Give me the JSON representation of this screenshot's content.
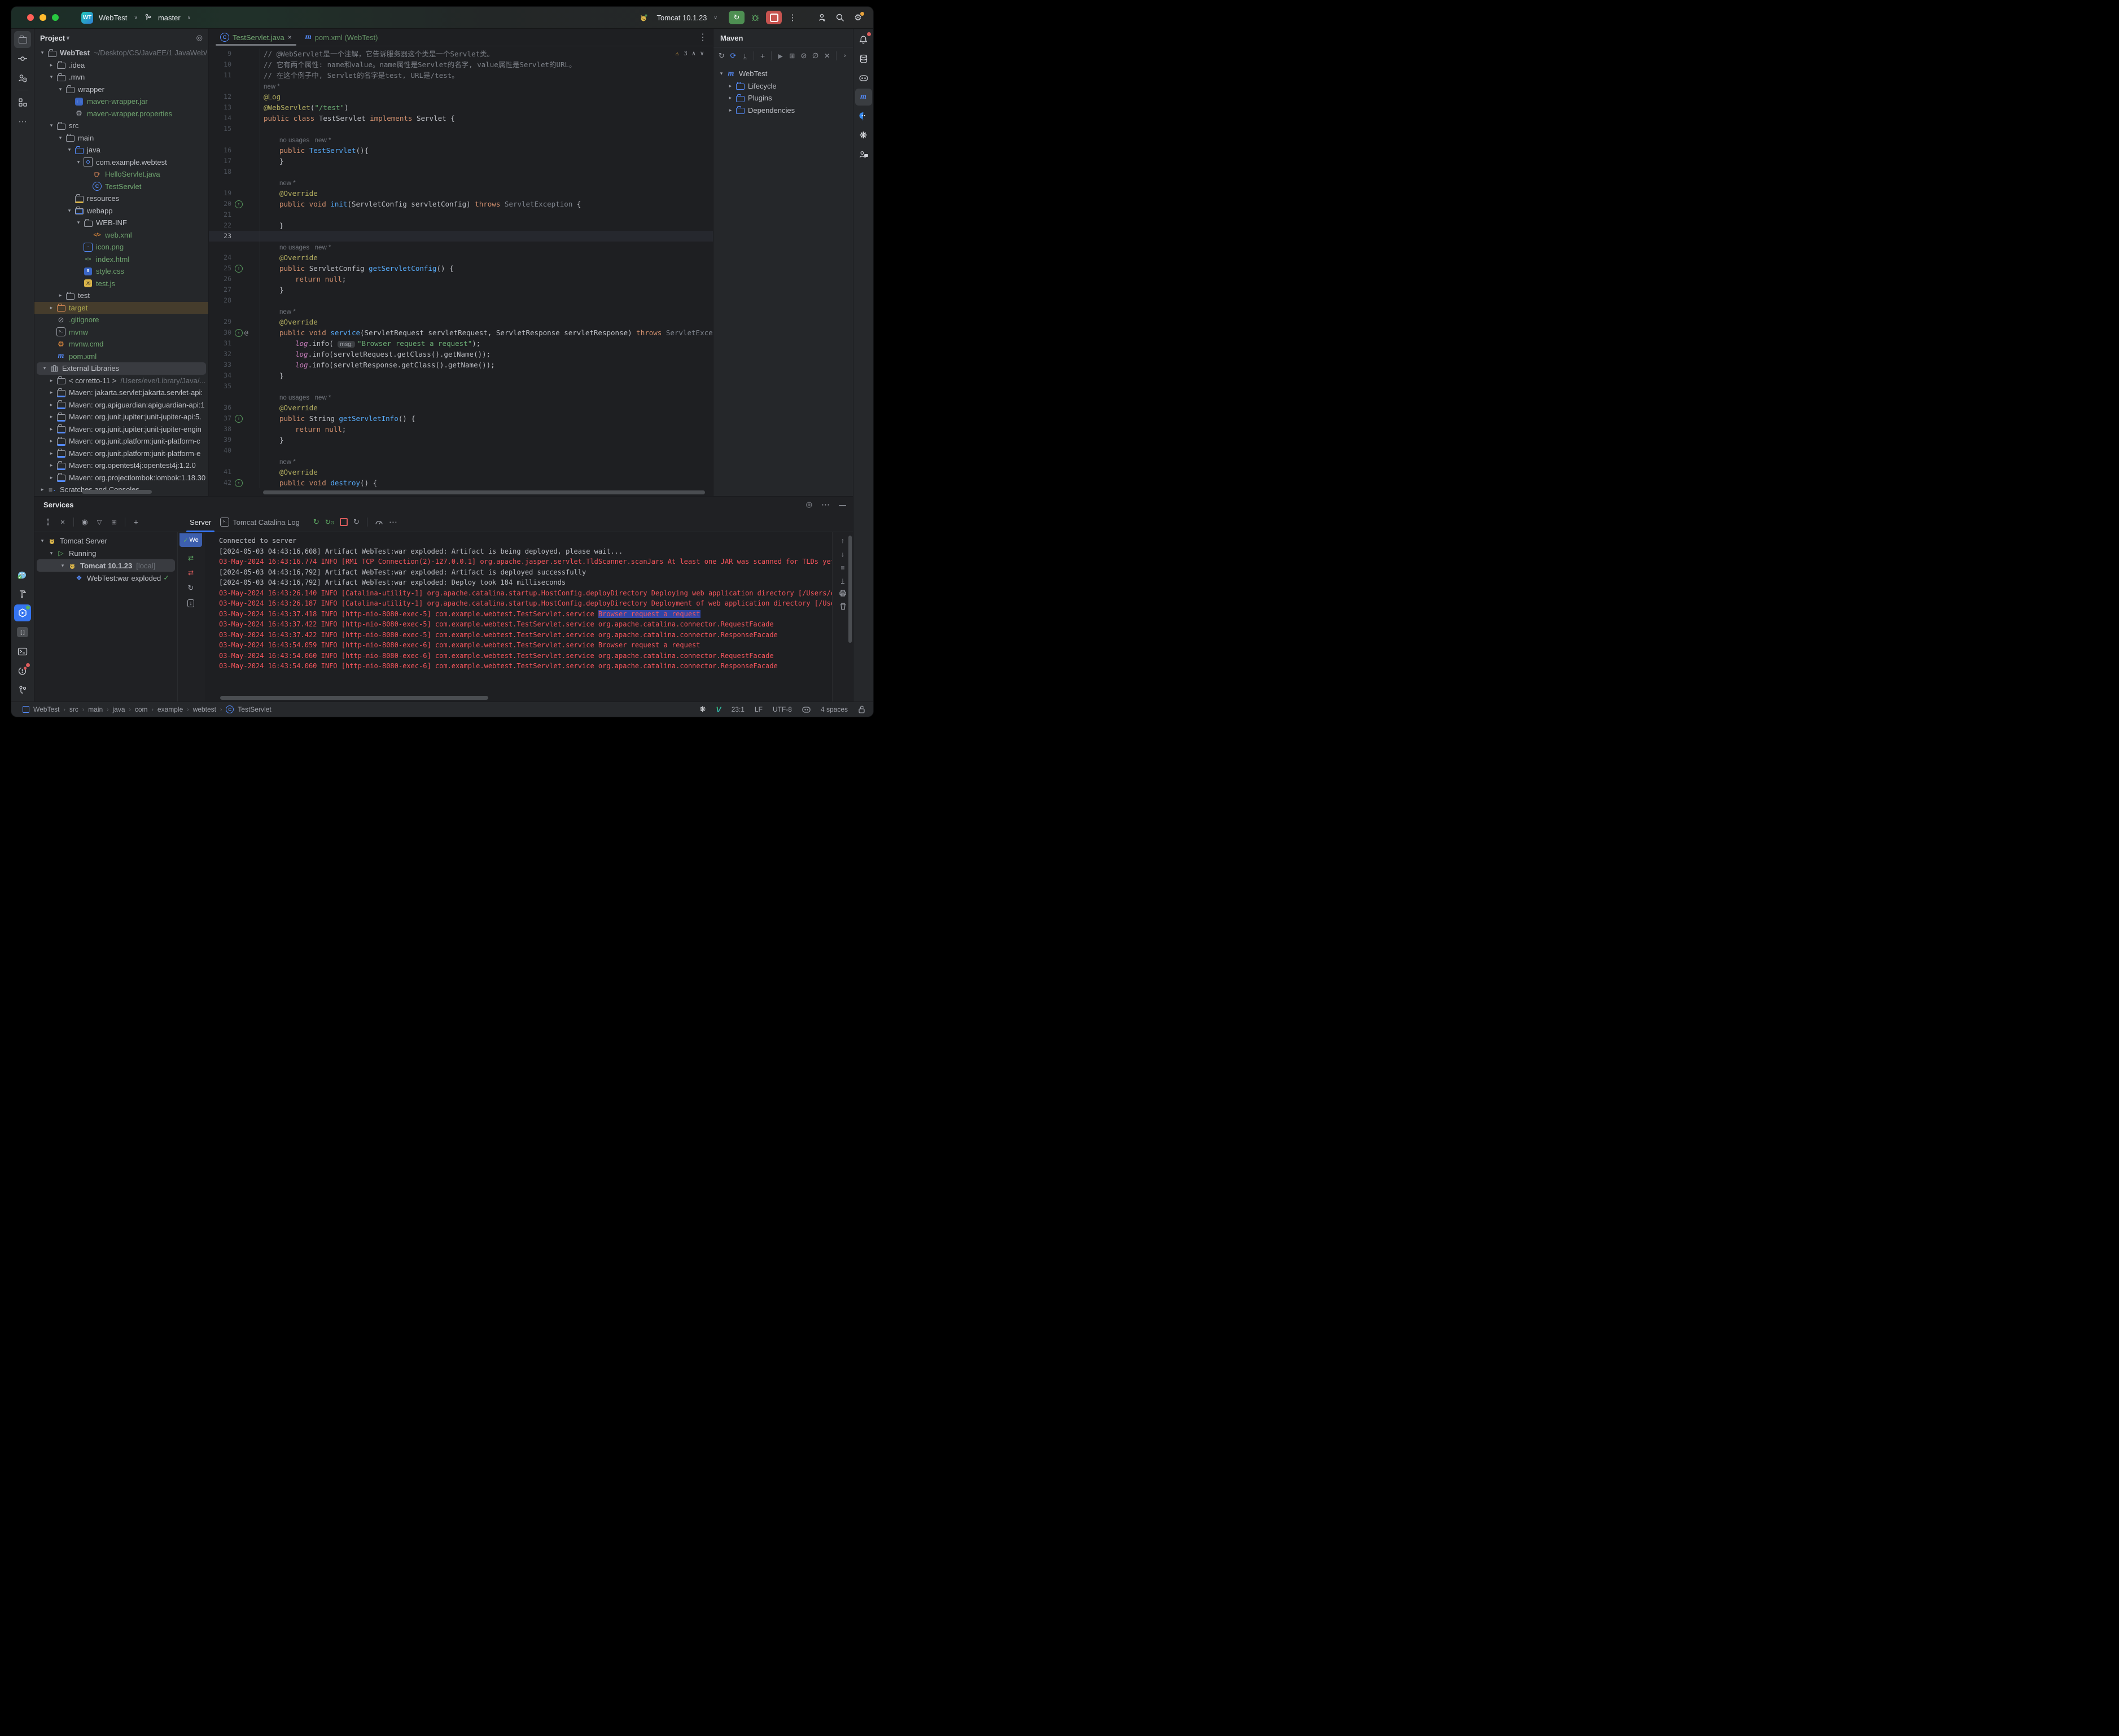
{
  "colors": {
    "accent": "#3574f0",
    "run_green": "#4e8f52",
    "stop_red": "#c75450",
    "traffic": [
      "#ff5f57",
      "#febc2e",
      "#28c840"
    ],
    "file_green": "#6fa46f",
    "log_error": "#f2545b",
    "selection_blue": "#2f45a5"
  },
  "titlebar": {
    "project_badge": "WT",
    "project_name": "WebTest",
    "branch": "master",
    "run_config": "Tomcat 10.1.23"
  },
  "left_strip_top": [
    {
      "icon": "folder",
      "name": "project",
      "active": true
    },
    {
      "icon": "commit",
      "name": "commit"
    },
    {
      "icon": "user-help",
      "name": "user-help"
    },
    {
      "icon": "structure",
      "name": "structure"
    },
    {
      "icon": "more",
      "name": "more-tools"
    }
  ],
  "left_strip_bottom": [
    {
      "icon": "docker",
      "name": "docker"
    },
    {
      "icon": "hammer",
      "name": "build"
    },
    {
      "icon": "services",
      "name": "services",
      "active_blue": true,
      "green_dot": true
    },
    {
      "icon": "brackets",
      "name": "notifications-console"
    },
    {
      "icon": "terminal",
      "name": "terminal"
    },
    {
      "icon": "problems",
      "name": "problems",
      "red_dot": true
    },
    {
      "icon": "git",
      "name": "version-control"
    }
  ],
  "right_strip": [
    {
      "icon": "bell",
      "name": "notifications",
      "red_dot": true
    },
    {
      "icon": "database",
      "name": "database"
    },
    {
      "icon": "copilot",
      "name": "copilot"
    },
    {
      "icon": "maven-m",
      "name": "maven",
      "active": true
    },
    {
      "icon": "chat",
      "name": "ai-chat"
    },
    {
      "icon": "openai",
      "name": "openai"
    },
    {
      "icon": "user-chat",
      "name": "copilot-chat"
    }
  ],
  "project": {
    "title": "Project",
    "tree": [
      {
        "d": 0,
        "chev": "v",
        "icon": "folder",
        "label": "WebTest",
        "bold": true,
        "path": "~/Desktop/CS/JavaEE/1 JavaWeb/"
      },
      {
        "d": 1,
        "chev": ">",
        "icon": "folder",
        "label": ".idea"
      },
      {
        "d": 1,
        "chev": "v",
        "icon": "folder",
        "label": ".mvn"
      },
      {
        "d": 2,
        "chev": "v",
        "icon": "folder",
        "label": "wrapper"
      },
      {
        "d": 3,
        "chev": "",
        "icon": "jar",
        "label": "maven-wrapper.jar",
        "green": true
      },
      {
        "d": 3,
        "chev": "",
        "icon": "gear",
        "label": "maven-wrapper.properties",
        "green": true
      },
      {
        "d": 1,
        "chev": "v",
        "icon": "folder",
        "label": "src"
      },
      {
        "d": 2,
        "chev": "v",
        "icon": "folder",
        "label": "main"
      },
      {
        "d": 3,
        "chev": "v",
        "icon": "folder-blue",
        "label": "java"
      },
      {
        "d": 4,
        "chev": "v",
        "icon": "package",
        "label": "com.example.webtest"
      },
      {
        "d": 5,
        "chev": "",
        "icon": "cup",
        "label": "HelloServlet.java",
        "green": true
      },
      {
        "d": 5,
        "chev": "",
        "icon": "class",
        "label": "TestServlet",
        "green": true
      },
      {
        "d": 3,
        "chev": "",
        "icon": "folder-res",
        "label": "resources"
      },
      {
        "d": 3,
        "chev": "v",
        "icon": "folder-web",
        "label": "webapp"
      },
      {
        "d": 4,
        "chev": "v",
        "icon": "folder",
        "label": "WEB-INF"
      },
      {
        "d": 5,
        "chev": "",
        "icon": "xml",
        "label": "web.xml",
        "green": true
      },
      {
        "d": 4,
        "chev": "",
        "icon": "image",
        "label": "icon.png",
        "green": true
      },
      {
        "d": 4,
        "chev": "",
        "icon": "html",
        "label": "index.html",
        "green": true
      },
      {
        "d": 4,
        "chev": "",
        "icon": "css",
        "label": "style.css",
        "green": true
      },
      {
        "d": 4,
        "chev": "",
        "icon": "js",
        "label": "test.js",
        "green": true
      },
      {
        "d": 2,
        "chev": ">",
        "icon": "folder",
        "label": "test"
      },
      {
        "d": 1,
        "chev": ">",
        "icon": "folder-orange",
        "label": "target",
        "target": true
      },
      {
        "d": 1,
        "chev": "",
        "icon": "slash",
        "label": ".gitignore",
        "green": true
      },
      {
        "d": 1,
        "chev": "",
        "icon": "shell",
        "label": "mvnw",
        "green": true
      },
      {
        "d": 1,
        "chev": "",
        "icon": "gear-orange",
        "label": "mvnw.cmd",
        "green": true
      },
      {
        "d": 1,
        "chev": "",
        "icon": "maven-m",
        "label": "pom.xml",
        "green": true
      },
      {
        "d": 0,
        "chev": "v",
        "icon": "libs",
        "label": "External Libraries",
        "sel": true
      },
      {
        "d": 1,
        "chev": ">",
        "icon": "jdk",
        "label": "< corretto-11 >",
        "path": "/Users/eve/Library/Java/..."
      },
      {
        "d": 1,
        "chev": ">",
        "icon": "mlib",
        "label": "Maven: jakarta.servlet:jakarta.servlet-api:"
      },
      {
        "d": 1,
        "chev": ">",
        "icon": "mlib",
        "label": "Maven: org.apiguardian:apiguardian-api:1"
      },
      {
        "d": 1,
        "chev": ">",
        "icon": "mlib",
        "label": "Maven: org.junit.jupiter:junit-jupiter-api:5."
      },
      {
        "d": 1,
        "chev": ">",
        "icon": "mlib",
        "label": "Maven: org.junit.jupiter:junit-jupiter-engin"
      },
      {
        "d": 1,
        "chev": ">",
        "icon": "mlib",
        "label": "Maven: org.junit.platform:junit-platform-c"
      },
      {
        "d": 1,
        "chev": ">",
        "icon": "mlib",
        "label": "Maven: org.junit.platform:junit-platform-e"
      },
      {
        "d": 1,
        "chev": ">",
        "icon": "mlib",
        "label": "Maven: org.opentest4j:opentest4j:1.2.0"
      },
      {
        "d": 1,
        "chev": ">",
        "icon": "mlib",
        "label": "Maven: org.projectlombok:lombok:1.18.30"
      },
      {
        "d": 0,
        "chev": ">",
        "icon": "scratch",
        "label": "Scratches and Consoles"
      }
    ]
  },
  "editor": {
    "tabs": [
      {
        "icon": "class",
        "label": "TestServlet.java",
        "close": "×",
        "active": true
      },
      {
        "icon": "maven-m",
        "label": "pom.xml (WebTest)"
      }
    ],
    "inspections": {
      "warnings": "3"
    },
    "lines": [
      {
        "n": "9",
        "seg": [
          [
            "cm",
            "// @WebServlet是一个注解，它告诉服务器这个类是一个Servlet类。"
          ]
        ]
      },
      {
        "n": "10",
        "seg": [
          [
            "cm",
            "// 它有两个属性: name和value。name属性是Servlet的名字, value属性是Servlet的URL。"
          ]
        ]
      },
      {
        "n": "11",
        "seg": [
          [
            "cm",
            "// 在这个例子中, Servlet的名字是test, URL是/test。"
          ]
        ]
      },
      {
        "inlay": "new *",
        "ind": 0
      },
      {
        "n": "12",
        "seg": [
          [
            "an",
            "@Log"
          ]
        ]
      },
      {
        "n": "13",
        "seg": [
          [
            "an",
            "@WebServlet"
          ],
          [
            "pl",
            "("
          ],
          [
            "st",
            "\"/test\""
          ],
          [
            "pl",
            ")"
          ]
        ]
      },
      {
        "n": "14",
        "seg": [
          [
            "kw",
            "public class "
          ],
          [
            "pl",
            "TestServlet "
          ],
          [
            "kw",
            "implements "
          ],
          [
            "pl",
            "Servlet {"
          ]
        ]
      },
      {
        "n": "15",
        "seg": []
      },
      {
        "inlay": "no usages   new *",
        "ind": 1
      },
      {
        "n": "16",
        "ind": 1,
        "seg": [
          [
            "kw",
            "public "
          ],
          [
            "mt",
            "TestServlet"
          ],
          [
            "pl",
            "(){"
          ]
        ]
      },
      {
        "n": "17",
        "ind": 1,
        "seg": [
          [
            "pl",
            "}"
          ]
        ]
      },
      {
        "n": "18",
        "seg": []
      },
      {
        "inlay": "new *",
        "ind": 1
      },
      {
        "n": "19",
        "ind": 1,
        "seg": [
          [
            "an",
            "@Override"
          ]
        ]
      },
      {
        "n": "20",
        "g": "ov",
        "ind": 1,
        "seg": [
          [
            "kw",
            "public void "
          ],
          [
            "mt",
            "init"
          ],
          [
            "pl",
            "(ServletConfig servletConfig) "
          ],
          [
            "kw",
            "throws "
          ],
          [
            "gr",
            "ServletException "
          ],
          [
            "pl",
            "{"
          ]
        ]
      },
      {
        "n": "21",
        "seg": []
      },
      {
        "n": "22",
        "ind": 1,
        "seg": [
          [
            "pl",
            "}"
          ]
        ]
      },
      {
        "n": "23",
        "cur": true,
        "seg": []
      },
      {
        "inlay": "no usages   new *",
        "ind": 1
      },
      {
        "n": "24",
        "ind": 1,
        "seg": [
          [
            "an",
            "@Override"
          ]
        ]
      },
      {
        "n": "25",
        "g": "ov",
        "ind": 1,
        "seg": [
          [
            "kw",
            "public "
          ],
          [
            "pl",
            "ServletConfig "
          ],
          [
            "mt",
            "getServletConfig"
          ],
          [
            "pl",
            "() {"
          ]
        ]
      },
      {
        "n": "26",
        "ind": 2,
        "seg": [
          [
            "kw",
            "return null"
          ],
          [
            "pl",
            ";"
          ]
        ]
      },
      {
        "n": "27",
        "ind": 1,
        "seg": [
          [
            "pl",
            "}"
          ]
        ]
      },
      {
        "n": "28",
        "seg": []
      },
      {
        "inlay": "new *",
        "ind": 1
      },
      {
        "n": "29",
        "ind": 1,
        "seg": [
          [
            "an",
            "@Override"
          ]
        ]
      },
      {
        "n": "30",
        "g": "ov@",
        "ind": 1,
        "seg": [
          [
            "kw",
            "public void "
          ],
          [
            "mt",
            "service"
          ],
          [
            "pl",
            "(ServletRequest servletRequest, ServletResponse servletResponse) "
          ],
          [
            "kw",
            "throws "
          ],
          [
            "gr",
            "ServletException, IOException"
          ]
        ]
      },
      {
        "n": "31",
        "ind": 2,
        "seg": [
          [
            "fd",
            "log"
          ],
          [
            "pl",
            ".info( "
          ],
          [
            "chip",
            "msg:"
          ],
          [
            "st",
            "\"Browser request a request\""
          ],
          [
            "pl",
            ");"
          ]
        ]
      },
      {
        "n": "32",
        "ind": 2,
        "seg": [
          [
            "fd",
            "log"
          ],
          [
            "pl",
            ".info(servletRequest.getClass().getName());"
          ]
        ]
      },
      {
        "n": "33",
        "ind": 2,
        "seg": [
          [
            "fd",
            "log"
          ],
          [
            "pl",
            ".info(servletResponse.getClass().getName());"
          ]
        ]
      },
      {
        "n": "34",
        "ind": 1,
        "seg": [
          [
            "pl",
            "}"
          ]
        ]
      },
      {
        "n": "35",
        "seg": []
      },
      {
        "inlay": "no usages   new *",
        "ind": 1
      },
      {
        "n": "36",
        "ind": 1,
        "seg": [
          [
            "an",
            "@Override"
          ]
        ]
      },
      {
        "n": "37",
        "g": "ov",
        "ind": 1,
        "seg": [
          [
            "kw",
            "public "
          ],
          [
            "pl",
            "String "
          ],
          [
            "mt",
            "getServletInfo"
          ],
          [
            "pl",
            "() {"
          ]
        ]
      },
      {
        "n": "38",
        "ind": 2,
        "seg": [
          [
            "kw",
            "return null"
          ],
          [
            "pl",
            ";"
          ]
        ]
      },
      {
        "n": "39",
        "ind": 1,
        "seg": [
          [
            "pl",
            "}"
          ]
        ]
      },
      {
        "n": "40",
        "seg": []
      },
      {
        "inlay": "new *",
        "ind": 1
      },
      {
        "n": "41",
        "ind": 1,
        "seg": [
          [
            "an",
            "@Override"
          ]
        ]
      },
      {
        "n": "42",
        "g": "ov",
        "ind": 1,
        "seg": [
          [
            "kw",
            "public void "
          ],
          [
            "mt",
            "destroy"
          ],
          [
            "pl",
            "() {"
          ]
        ]
      }
    ]
  },
  "maven": {
    "title": "Maven",
    "toolbar": [
      "refresh",
      "reload",
      "download",
      "sep",
      "plus",
      "sep",
      "play",
      "runconfig",
      "offline",
      "skiptests",
      "mute",
      "sep",
      "chevright"
    ],
    "tree": [
      {
        "d": 0,
        "chev": "v",
        "icon": "maven-m",
        "label": "WebTest"
      },
      {
        "d": 1,
        "chev": ">",
        "icon": "folder-gear",
        "label": "Lifecycle"
      },
      {
        "d": 1,
        "chev": ">",
        "icon": "folder-gear",
        "label": "Plugins"
      },
      {
        "d": 1,
        "chev": ">",
        "icon": "folder-chart",
        "label": "Dependencies"
      }
    ]
  },
  "services": {
    "title": "Services",
    "header_icons": [
      "target",
      "more",
      "hide"
    ],
    "left_toolbar": [
      "expand",
      "collapse",
      "sep",
      "eye",
      "filter",
      "newtab",
      "sep",
      "plus"
    ],
    "tabs": [
      {
        "label": "Server",
        "active": true
      },
      {
        "label": "Tomcat Catalina Log",
        "icon": "terminal-mini"
      }
    ],
    "run_icons": [
      "rerun",
      "rerun-debug",
      "stop",
      "refresh",
      "sep",
      "gauge",
      "more"
    ],
    "tree": [
      {
        "d": 0,
        "chev": "v",
        "icon": "tomcat",
        "label": "Tomcat Server"
      },
      {
        "d": 1,
        "chev": "v",
        "icon": "play-outline",
        "label": "Running"
      },
      {
        "d": 2,
        "chev": "v",
        "icon": "tomcat",
        "label": "Tomcat 10.1.23",
        "suffix": "[local]",
        "bold": true,
        "sel": true
      },
      {
        "d": 3,
        "chev": "",
        "icon": "artifact",
        "label": "WebTest:war exploded",
        "check": true
      }
    ],
    "deploy_tab": {
      "check": "✓",
      "label": "We"
    },
    "strip_icons": [
      "swap-green",
      "swap-red",
      "refresh",
      "import-box"
    ],
    "console_icons": [
      "up",
      "down",
      "softwrap",
      "scrollend",
      "print",
      "trash"
    ],
    "logs": [
      {
        "c": "lw",
        "t": "Connected to server"
      },
      {
        "c": "lw",
        "t": "[2024-05-03 04:43:16,608] Artifact WebTest:war exploded: Artifact is being deployed, please wait..."
      },
      {
        "c": "lr",
        "t": "03-May-2024 16:43:16.774 INFO [RMI TCP Connection(2)-127.0.0.1] org.apache.jasper.servlet.TldScanner.scanJars At least one JAR was scanned for TLDs yet contained no TLDs."
      },
      {
        "c": "lw",
        "t": "[2024-05-03 04:43:16,792] Artifact WebTest:war exploded: Artifact is deployed successfully"
      },
      {
        "c": "lw",
        "t": "[2024-05-03 04:43:16,792] Artifact WebTest:war exploded: Deploy took 184 milliseconds"
      },
      {
        "c": "lr",
        "t": "03-May-2024 16:43:26.140 INFO [Catalina-utility-1] org.apache.catalina.startup.HostConfig.deployDirectory Deploying web application directory [/Users/eve/Desktop/CS/Ja"
      },
      {
        "c": "lr",
        "t": "03-May-2024 16:43:26.187 INFO [Catalina-utility-1] org.apache.catalina.startup.HostConfig.deployDirectory Deployment of web application directory [/Users/eve/Desktop/C"
      },
      {
        "c": "lr",
        "t": "03-May-2024 16:43:37.418 INFO [http-nio-8080-exec-5] com.example.webtest.TestServlet.service ",
        "hl": "Browser request a request"
      },
      {
        "c": "lr",
        "t": "03-May-2024 16:43:37.422 INFO [http-nio-8080-exec-5] com.example.webtest.TestServlet.service org.apache.catalina.connector.RequestFacade"
      },
      {
        "c": "lr",
        "t": "03-May-2024 16:43:37.422 INFO [http-nio-8080-exec-5] com.example.webtest.TestServlet.service org.apache.catalina.connector.ResponseFacade"
      },
      {
        "c": "lr",
        "t": "03-May-2024 16:43:54.059 INFO [http-nio-8080-exec-6] com.example.webtest.TestServlet.service Browser request a request"
      },
      {
        "c": "lr",
        "t": "03-May-2024 16:43:54.060 INFO [http-nio-8080-exec-6] com.example.webtest.TestServlet.service org.apache.catalina.connector.RequestFacade"
      },
      {
        "c": "lr",
        "t": "03-May-2024 16:43:54.060 INFO [http-nio-8080-exec-6] com.example.webtest.TestServlet.service org.apache.catalina.connector.ResponseFacade"
      }
    ]
  },
  "statusbar": {
    "breadcrumbs": [
      "WebTest",
      "src",
      "main",
      "java",
      "com",
      "example",
      "webtest",
      "TestServlet"
    ],
    "caret": "23:1",
    "line_sep": "LF",
    "encoding": "UTF-8",
    "indent": "4 spaces"
  }
}
